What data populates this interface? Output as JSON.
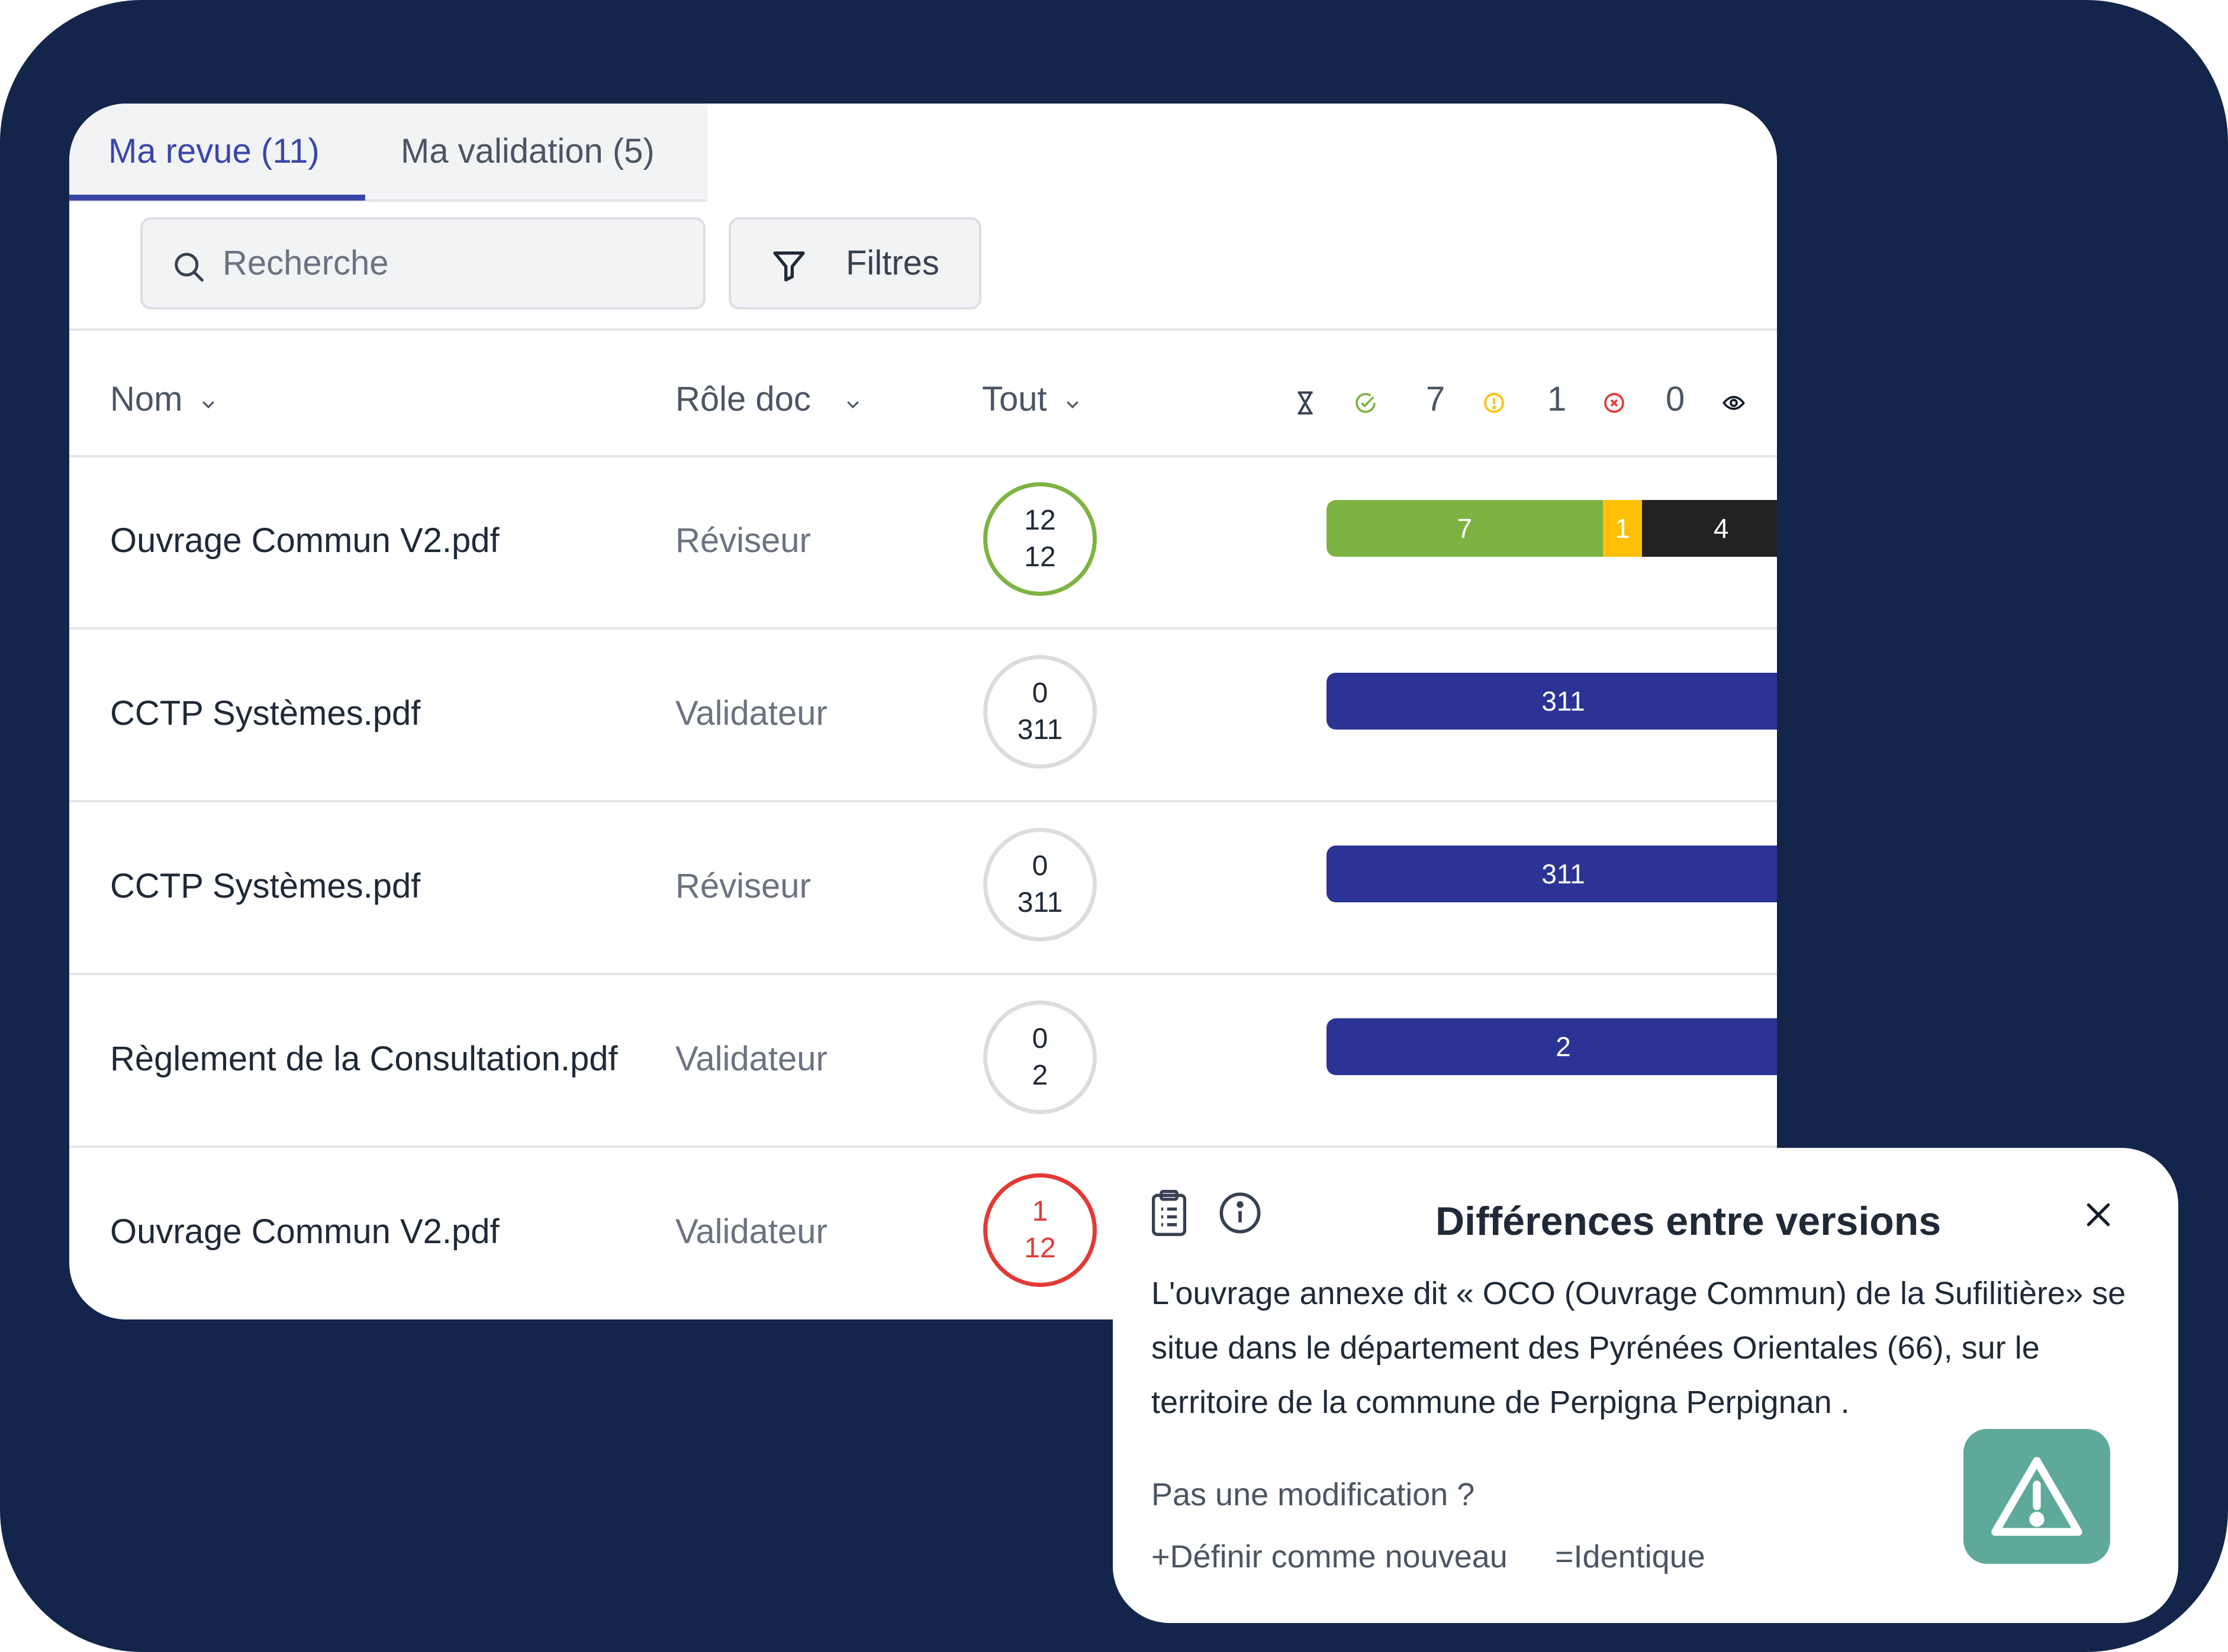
{
  "tabs": [
    {
      "label": "Ma revue (11)",
      "active": true
    },
    {
      "label": "Ma validation (5)",
      "active": false
    }
  ],
  "search": {
    "placeholder": "Recherche"
  },
  "filters": {
    "label": "Filtres"
  },
  "columns": {
    "name": "Nom",
    "role": "Rôle doc",
    "all": "Tout"
  },
  "stats": {
    "approved": "7",
    "warning": "1",
    "rejected": "0",
    "viewed": "4"
  },
  "rows": [
    {
      "name": "Ouvrage Commun V2.pdf",
      "role": "Réviseur",
      "count_top": "12",
      "count_bottom": "12",
      "bar": [
        {
          "label": "7",
          "value": 7,
          "color": "#7cb342"
        },
        {
          "label": "1",
          "value": 1,
          "color": "#ffc107"
        },
        {
          "label": "4",
          "value": 4,
          "color": "#222222"
        }
      ]
    },
    {
      "name": "CCTP Systèmes.pdf",
      "role": "Validateur",
      "count_top": "0",
      "count_bottom": "311",
      "bar_label": "311"
    },
    {
      "name": "CCTP Systèmes.pdf",
      "role": "Réviseur",
      "count_top": "0",
      "count_bottom": "311",
      "bar_label": "311"
    },
    {
      "name": "Règlement de la Consultation.pdf",
      "role": "Validateur",
      "count_top": "0",
      "count_bottom": "2",
      "bar_label": "2"
    },
    {
      "name": "Ouvrage Commun V2.pdf",
      "role": "Validateur",
      "count_top": "1",
      "count_bottom": "12"
    }
  ],
  "popup": {
    "title": "Différences entre versions",
    "body": "L'ouvrage annexe dit « OCO (Ouvrage Commun) de la Sufilitière» se situe dans le département des Pyrénées Orientales (66), sur le territoire de la commune de Perpigna Perpignan .",
    "question": "Pas une modification ?",
    "action_new": "+Définir comme nouveau",
    "action_same": "=Identique"
  },
  "colors": {
    "primary": "#3946a8",
    "bar_blue": "#2b3494",
    "green": "#7cb342",
    "yellow": "#ffc107",
    "red": "#e53935",
    "teal": "#5fa99a",
    "background": "#13254a"
  },
  "icons": [
    "search-icon",
    "filter-icon",
    "chevron-down-icon",
    "hourglass-icon",
    "check-circle-icon",
    "alert-circle-icon",
    "x-circle-icon",
    "eye-icon",
    "clipboard-icon",
    "info-icon",
    "close-icon",
    "warning-icon"
  ]
}
